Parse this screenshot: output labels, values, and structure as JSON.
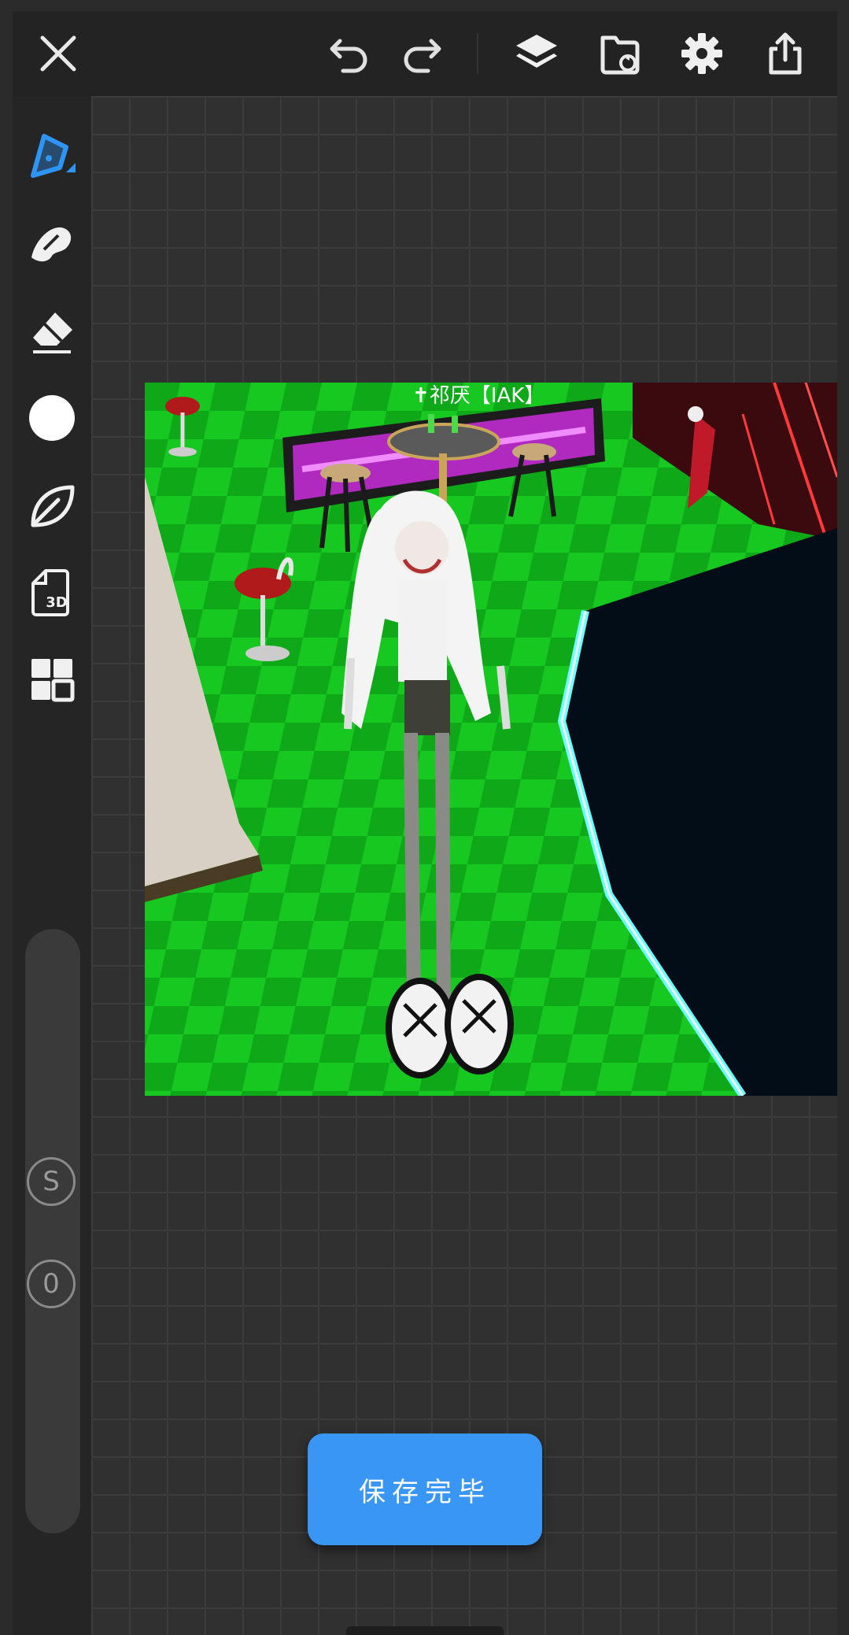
{
  "toolbar": {
    "close_icon": "close-icon",
    "undo_icon": "undo-icon",
    "redo_icon": "redo-icon",
    "layers_icon": "layers-icon",
    "gallery_icon": "gallery-icon",
    "settings_icon": "gear-icon",
    "share_icon": "share-icon"
  },
  "tools": [
    {
      "name": "pen-tool",
      "icon": "pen-icon",
      "active": true
    },
    {
      "name": "smudge-tool",
      "icon": "smudge-icon"
    },
    {
      "name": "eraser-tool",
      "icon": "eraser-icon"
    },
    {
      "name": "color-tool",
      "icon": "color-circle-icon",
      "color": "#ffffff"
    },
    {
      "name": "shape-tool",
      "icon": "leaf-icon"
    },
    {
      "name": "3d-tool",
      "icon": "3d-file-icon",
      "label": "3D"
    },
    {
      "name": "grid-tool",
      "icon": "grid-icon"
    }
  ],
  "side_controls": {
    "size_label": "S",
    "opacity_label": "0"
  },
  "photo": {
    "overlay_text": "✝祁厌【IAK】"
  },
  "save_button": {
    "label": "保存完毕"
  },
  "colors": {
    "accent": "#3a96f5",
    "toolbar_bg": "#232323",
    "canvas_bg": "#303030",
    "floor_green": "#12c81a"
  }
}
